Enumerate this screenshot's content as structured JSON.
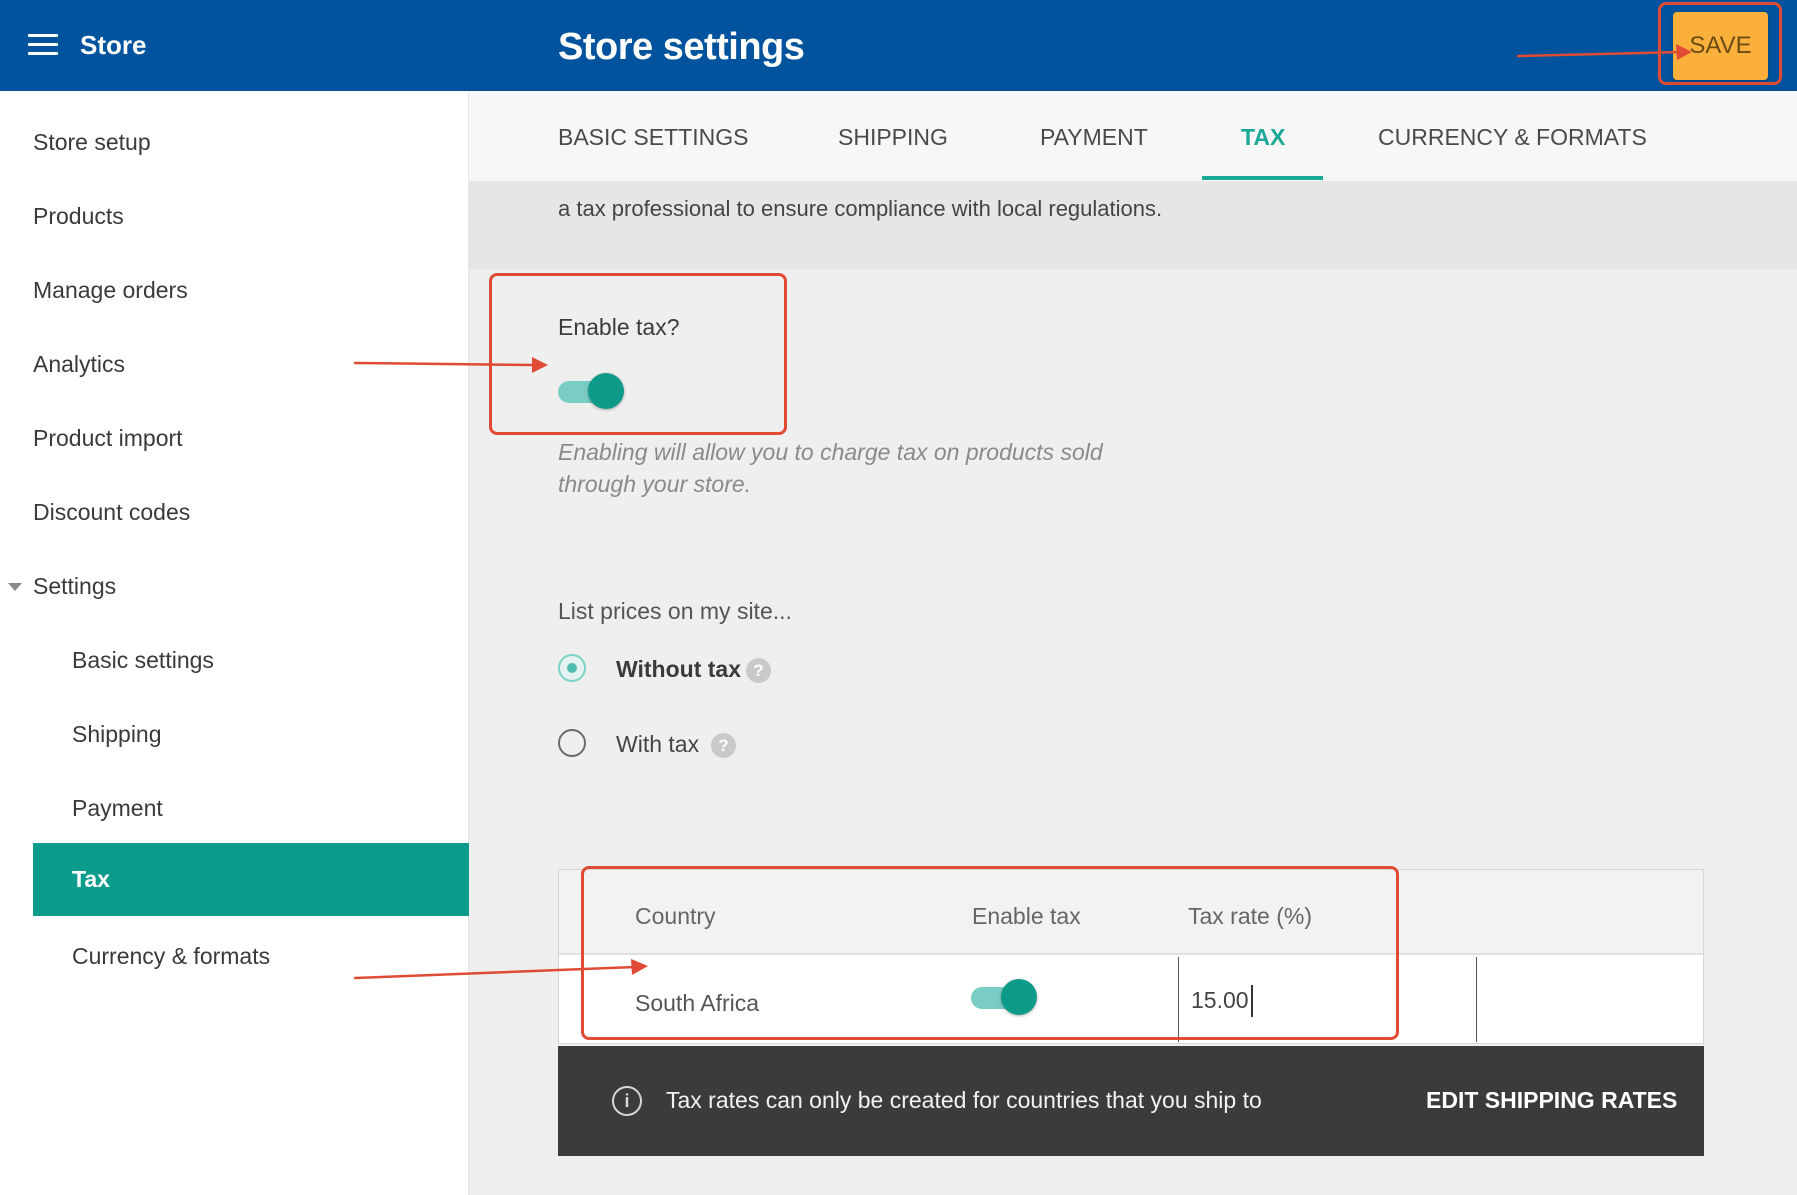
{
  "header": {
    "store_label": "Store",
    "title": "Store settings",
    "save_label": "SAVE"
  },
  "sidebar": {
    "items": [
      {
        "label": "Store setup"
      },
      {
        "label": "Products"
      },
      {
        "label": "Manage orders"
      },
      {
        "label": "Analytics"
      },
      {
        "label": "Product import"
      },
      {
        "label": "Discount codes"
      },
      {
        "label": "Settings"
      }
    ],
    "sub_items": [
      {
        "label": "Basic settings"
      },
      {
        "label": "Shipping"
      },
      {
        "label": "Payment"
      },
      {
        "label": "Tax"
      },
      {
        "label": "Currency & formats"
      }
    ]
  },
  "tabs": [
    {
      "label": "BASIC SETTINGS"
    },
    {
      "label": "SHIPPING"
    },
    {
      "label": "PAYMENT"
    },
    {
      "label": "TAX"
    },
    {
      "label": "CURRENCY & FORMATS"
    }
  ],
  "active_tab": "TAX",
  "notice": {
    "text": "a tax professional to ensure compliance with local regulations."
  },
  "tax": {
    "enable_label": "Enable tax?",
    "enabled": true,
    "help_text": "Enabling will allow you to charge tax on products sold through your store.",
    "list_prices_label": "List prices on my site...",
    "options": [
      {
        "label": "Without tax",
        "selected": true
      },
      {
        "label": "With tax",
        "selected": false
      }
    ],
    "help_glyph": "?"
  },
  "table": {
    "headers": [
      "Country",
      "Enable tax",
      "Tax rate (%)"
    ],
    "rows": [
      {
        "country": "South Africa",
        "enabled": true,
        "rate": "15.00"
      }
    ]
  },
  "footer": {
    "info_glyph": "i",
    "message": "Tax rates can only be created for countries that you ship to",
    "link": "EDIT SHIPPING RATES"
  },
  "colors": {
    "header_bg": "#00539c",
    "accent": "#0b9c8c",
    "save_bg": "#fbb03b",
    "annotation": "#e04b35"
  }
}
